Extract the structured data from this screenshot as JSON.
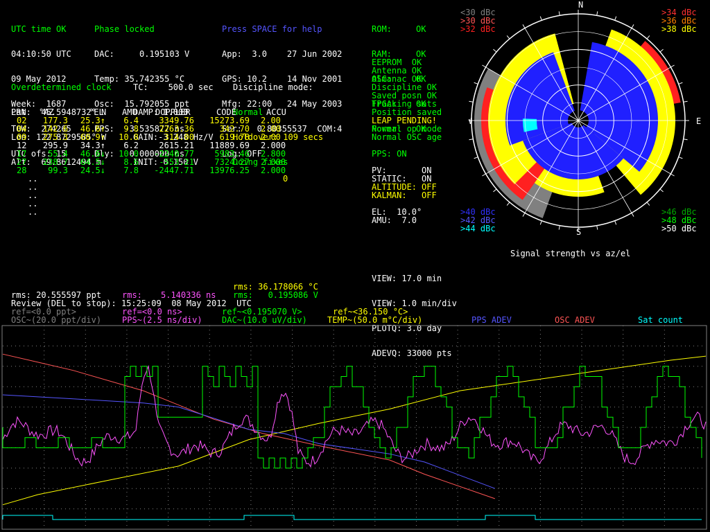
{
  "status": {
    "utc_time_ok": "UTC time OK",
    "time": "04:10:50 UTC",
    "date": "09 May 2012",
    "week": "Week:  1687",
    "tow": "TOW:  274265",
    "utc_ofs": "UTC ofs: 15"
  },
  "phase": {
    "title": "Phase locked",
    "lines": [
      "DAC:     0.195103 V",
      "Temp: 35.742355 °C",
      "Osc:  15.792055 ppt",
      "PPS:  -3.535877 ns",
      "Dly:   0.000000 ns"
    ]
  },
  "help": {
    "title": "Press SPACE for help",
    "lines": [
      "App:  3.0    27 Jun 2002",
      "GPS: 10.2    14 Nov 2001",
      "Mfg: 22:00   24 May 2003",
      "Ser:   0.80355537  COM:4",
      "Log: OFF"
    ]
  },
  "health": {
    "items": [
      {
        "name": "ROM:",
        "status": "OK"
      },
      {
        "name": "RAM:",
        "status": "OK"
      },
      {
        "name": "OSC:",
        "status": "OK"
      },
      {
        "name": "FPGA:",
        "status": "OK"
      },
      {
        "name": "Power:",
        "status": "OK"
      }
    ],
    "status_lines": [
      {
        "text": "EEPROM  OK",
        "color": "#00ff00"
      },
      {
        "text": "Antenna OK",
        "color": "#00ff00"
      },
      {
        "text": "Almanac OK",
        "color": "#00ff00"
      },
      {
        "text": "Discipline OK",
        "color": "#00ff00"
      },
      {
        "text": "Saved posn OK",
        "color": "#00ff00"
      },
      {
        "text": "Tracking sats",
        "color": "#00ff00"
      },
      {
        "text": "Position saved",
        "color": "#00ff00"
      },
      {
        "text": "LEAP PENDING!",
        "color": "#ffff00"
      },
      {
        "text": "Normal op mode",
        "color": "#00ff00"
      },
      {
        "text": "Normal OSC age",
        "color": "#00ff00"
      }
    ],
    "pps": "PPS: ON"
  },
  "modes": {
    "lines": [
      {
        "label": "PV:",
        "value": "ON",
        "color": "#ffffff"
      },
      {
        "label": "STATIC:",
        "value": "ON",
        "color": "#ffffff"
      },
      {
        "label": "ALTITUDE:",
        "value": "OFF",
        "color": "#ffff00"
      },
      {
        "label": "KALMAN:",
        "value": "OFF",
        "color": "#ffff00"
      }
    ],
    "el": "EL:  10.0°",
    "amu": "AMU:  7.0"
  },
  "clock": {
    "title": "Overdetermined clock",
    "lines": [
      "Lat:  45.5948732° N",
      "Lon: 122.8729585° W",
      "Alt:  69.8612494 m"
    ],
    "params": [
      "TC:    500.0 sec",
      "DAMP: 1.000",
      "GAIN:-3.248 Hz/V",
      "INIT: 0.150 V"
    ],
    "discipline_label": "Discipline mode:",
    "discipline_lines": [
      {
        "text": "Normal",
        "color": "#00ff00"
      },
      {
        "text": "Holdover: 109 secs",
        "color": "#ffff00"
      },
      {
        "text": "Doing fixes",
        "color": "#00ff00"
      }
    ]
  },
  "sat_table": {
    "headers": [
      "PRN",
      "°AZ",
      "°EL",
      "AMU",
      "DOPPLER",
      "CODE",
      "ACCU"
    ],
    "rows": [
      {
        "prn": "02",
        "az": "177.3",
        "el": "25.3↑",
        "amu": "6.4",
        "doppler": "3349.76",
        "code": "15273.69",
        "accu": "2.00",
        "color": "#ffff00"
      },
      {
        "prn": "04",
        "az": "142.6",
        "el": "46.6↑",
        "amu": "9.8",
        "doppler": "2263.36",
        "code": "342.70",
        "accu": "2.00",
        "color": "#ffff00"
      },
      {
        "prn": "09",
        "az": "275.3",
        "el": "60.9↑",
        "amu": "10.8",
        "doppler": "314.00",
        "code": "619.78",
        "accu": "2.00",
        "color": "#ffff00"
      },
      {
        "prn": "12",
        "az": "295.9",
        "el": "34.3↑",
        "amu": "6.2",
        "doppler": "2615.21",
        "code": "11889.69",
        "accu": "2.000",
        "color": "#ffffff"
      },
      {
        "prn": "17",
        "az": "55.4",
        "el": "46.6↓",
        "amu": "10.0",
        "doppler": "-2240.77",
        "code": "5983.46",
        "accu": "2.800",
        "color": "#00ff00"
      },
      {
        "prn": "27",
        "az": "238.7",
        "el": "64.5↓",
        "amu": "8.6",
        "doppler": "-553.21",
        "code": "7324.27",
        "accu": "2.000",
        "color": "#00ff00"
      },
      {
        "prn": "28",
        "az": "99.3",
        "el": "24.5↓",
        "amu": "7.8",
        "doppler": "-2447.71",
        "code": "13976.25",
        "accu": "2.000",
        "color": "#00ff00"
      }
    ],
    "extra_zero": "0",
    "dots": [
      "..",
      "..",
      "..",
      "..",
      ".."
    ]
  },
  "signal_legend": {
    "top_left": [
      {
        "text": "<30 dBc",
        "color": "#808080"
      },
      {
        "text": ">30 dBc",
        "color": "#ff5555"
      },
      {
        "text": ">32 dBc",
        "color": "#ff2020"
      }
    ],
    "top_right": [
      {
        "text": ">34 dBc",
        "color": "#ff3030"
      },
      {
        "text": ">36 dBc",
        "color": "#ff8000"
      },
      {
        "text": ">38 dBc",
        "color": "#ffff00"
      }
    ],
    "bottom_left": [
      {
        "text": ">40 dBc",
        "color": "#3030ff"
      },
      {
        "text": ">42 dBc",
        "color": "#5555ff"
      },
      {
        "text": ">44 dBc",
        "color": "#00ffff"
      }
    ],
    "bottom_right": [
      {
        "text": ">46 dBc",
        "color": "#00aa00"
      },
      {
        "text": ">48 dBc",
        "color": "#00ff00"
      },
      {
        "text": ">50 dBc",
        "color": "#ffffff"
      }
    ],
    "compass": {
      "n": "N",
      "s": "S",
      "e": "E",
      "w": "W"
    },
    "caption": "Signal strength vs az/el"
  },
  "view": {
    "lines": [
      "VIEW: 17.0 min",
      "VIEW: 1.0 min/div",
      "PLOTQ: 3.0 day",
      "ADEVQ: 33000 pts"
    ]
  },
  "stats": {
    "rms_temp": "rms: 36.178066 °C",
    "rms_pps_label": "rms:",
    "rms_pps_value": "5.140336 ns",
    "rms_dac": "rms:   0.195086 V",
    "rms_osc": "rms: 20.555597 ppt",
    "review": "Review (DEL to stop): 15:25:09  08 May 2012  UTC"
  },
  "graph_legend": {
    "osc_ref": "ref=<0.0 ppt>",
    "osc_scale": "OSC~(20.0 ppt/div)",
    "pps_ref": "ref=<0.0 ns>",
    "pps_scale": "PPS~(2.5 ns/div)",
    "dac_ref": "ref~<0.195070 V>",
    "dac_scale": "DAC~(10.0 uV/div)",
    "temp_ref": "ref~<36.150 °C>",
    "temp_scale": "TEMP~(50.0 m°C/div)",
    "pps_adev": "PPS ADEV",
    "osc_adev": "OSC ADEV",
    "sat_count": "Sat count"
  },
  "colors": {
    "osc": "#808080",
    "pps": "#ff55ff",
    "dac": "#00ff00",
    "temp": "#ffff00",
    "pps_adev": "#5555ff",
    "osc_adev": "#ff5555",
    "sat_count": "#00ffff"
  },
  "chart_data": {
    "type": "line",
    "title": "",
    "series": [
      {
        "name": "TEMP",
        "color": "#ffff00",
        "x": [
          0,
          0.05,
          0.15,
          0.25,
          0.35,
          0.45,
          0.55,
          0.65,
          0.75,
          0.85,
          0.95,
          1.0
        ],
        "values": [
          -3.8,
          -3.3,
          -2.6,
          -1.9,
          -0.6,
          0.2,
          0.9,
          1.8,
          2.3,
          2.8,
          3.3,
          3.5
        ]
      },
      {
        "name": "OSC ADEV",
        "color": "#ff5555",
        "x": [
          0,
          0.05,
          0.1,
          0.2,
          0.3,
          0.35,
          0.37,
          0.45,
          0.55,
          0.6,
          0.7
        ],
        "values": [
          3.6,
          3.2,
          2.8,
          1.8,
          0.4,
          -0.1,
          -0.3,
          -0.9,
          -1.6,
          -2.3,
          -3.5
        ]
      },
      {
        "name": "PPS ADEV",
        "color": "#5555ff",
        "x": [
          0,
          0.1,
          0.2,
          0.25,
          0.35,
          0.4,
          0.45,
          0.55,
          0.6,
          0.7
        ],
        "values": [
          1.6,
          1.4,
          1.2,
          1.0,
          -0.1,
          -0.3,
          -0.8,
          -1.3,
          -1.7,
          -3.0
        ]
      }
    ]
  }
}
